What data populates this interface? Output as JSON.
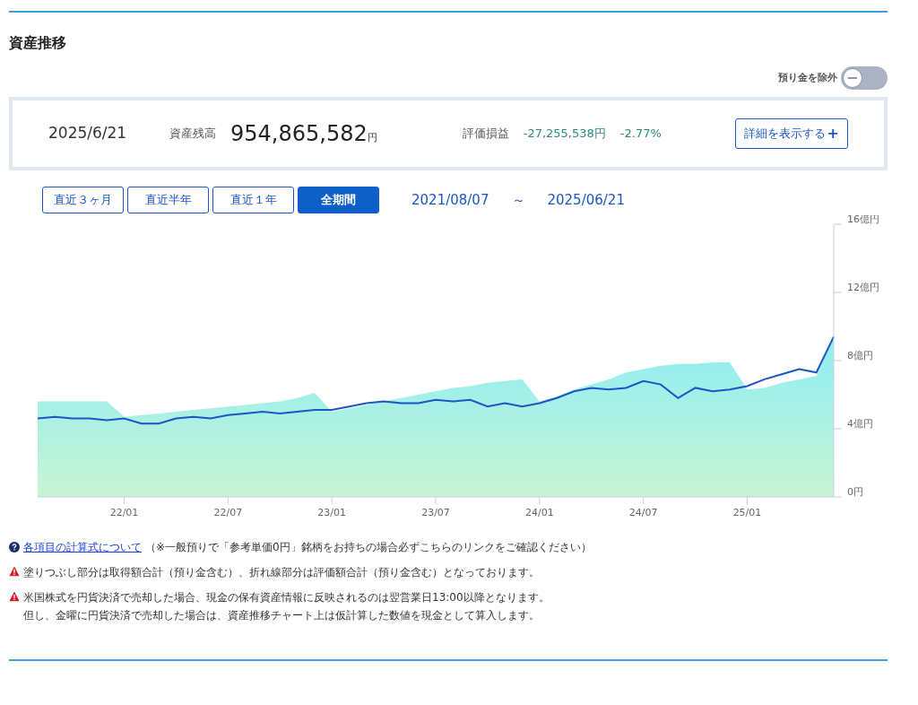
{
  "title": "資産推移",
  "toggle": {
    "label": "預り金を除外",
    "on": false
  },
  "summary": {
    "date": "2025/6/21",
    "balance_label": "資産残高",
    "balance": "954,865,582",
    "balance_unit": "円",
    "pl_label": "評価損益",
    "pl_amount": "-27,255,538円",
    "pl_percent": "-2.77%",
    "detail_button": "詳細を表示する",
    "detail_icon": "+"
  },
  "ranges": [
    {
      "label": "直近３ヶ月",
      "selected": false
    },
    {
      "label": "直近半年",
      "selected": false
    },
    {
      "label": "直近１年",
      "selected": false
    },
    {
      "label": "全期間",
      "selected": true
    }
  ],
  "period": {
    "start": "2021/08/07",
    "separator": "～",
    "end": "2025/06/21"
  },
  "chart": {
    "chart_data": {
      "type": "area",
      "categories": [
        null,
        null,
        null,
        null,
        null,
        "22/01",
        null,
        null,
        null,
        null,
        null,
        "22/07",
        null,
        null,
        null,
        null,
        null,
        "23/01",
        null,
        null,
        null,
        null,
        null,
        "23/07",
        null,
        null,
        null,
        null,
        null,
        "24/01",
        null,
        null,
        null,
        null,
        null,
        "24/07",
        null,
        null,
        null,
        null,
        null,
        "25/01",
        null,
        null,
        null,
        null,
        null
      ],
      "series": [
        {
          "type": "area",
          "color": "#8eeef4",
          "values": [
            5.6,
            5.6,
            5.6,
            5.6,
            5.6,
            4.7,
            4.8,
            4.9,
            5.0,
            5.1,
            5.2,
            5.3,
            5.4,
            5.5,
            5.6,
            5.8,
            6.1,
            5.0,
            5.2,
            5.4,
            5.6,
            5.8,
            6.0,
            6.2,
            6.4,
            6.5,
            6.7,
            6.8,
            6.9,
            5.6,
            5.9,
            6.3,
            6.6,
            6.9,
            7.3,
            7.5,
            7.7,
            7.8,
            7.8,
            7.9,
            7.9,
            6.3,
            6.4,
            6.7,
            6.9,
            7.1,
            9.4
          ]
        },
        {
          "type": "line",
          "color": "#1a56c4",
          "values": [
            4.6,
            4.7,
            4.6,
            4.6,
            4.5,
            4.6,
            4.3,
            4.3,
            4.6,
            4.7,
            4.6,
            4.8,
            4.9,
            5.0,
            4.9,
            5.0,
            5.1,
            5.1,
            5.3,
            5.5,
            5.6,
            5.5,
            5.5,
            5.7,
            5.6,
            5.7,
            5.3,
            5.5,
            5.3,
            5.5,
            5.8,
            6.2,
            6.4,
            6.3,
            6.4,
            6.8,
            6.6,
            5.8,
            6.4,
            6.2,
            6.3,
            6.5,
            6.9,
            7.2,
            7.5,
            7.3,
            9.4
          ]
        }
      ],
      "ylim": [
        0,
        16
      ],
      "yticks": [
        {
          "value": 0,
          "label": "0円"
        },
        {
          "value": 4,
          "label": "4億円"
        },
        {
          "value": 8,
          "label": "8億円"
        },
        {
          "value": 12,
          "label": "12億円"
        },
        {
          "value": 16,
          "label": "16億円"
        }
      ]
    }
  },
  "notes": [
    {
      "kind": "help",
      "link": "各項目の計算式について",
      "text": "（※一般預りで「参考単価0円」銘柄をお持ちの場合必ずこちらのリンクをご確認ください）"
    },
    {
      "kind": "warning",
      "lines": [
        "塗りつぶし部分は取得額合計（預り金含む）、折れ線部分は評価額合計（預り金含む）となっております。"
      ]
    },
    {
      "kind": "warning",
      "lines": [
        "米国株式を円貨決済で売却した場合、現金の保有資産情報に反映されるのは翌営業日13:00以降となります。",
        "但し、金曜に円貨決済で売却した場合は、資産推移チャート上は仮計算した数値を現金として算入します。"
      ]
    }
  ]
}
